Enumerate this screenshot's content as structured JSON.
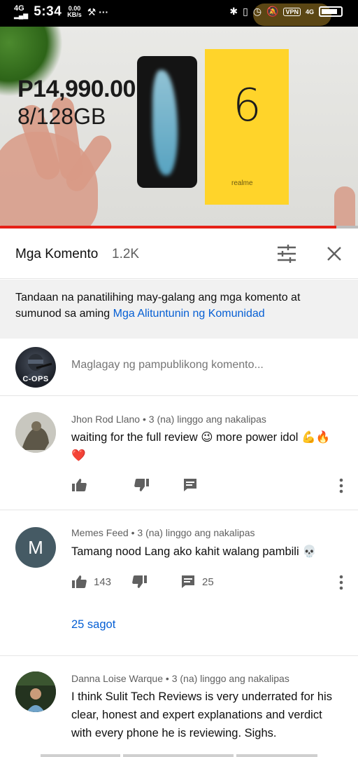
{
  "status_bar": {
    "network": "4G",
    "time": "5:34",
    "speed_value": "0.00",
    "speed_unit": "KB/s",
    "vpn": "VPN",
    "net_type": "4G"
  },
  "video": {
    "price_text": "P14,990.00",
    "storage_text": "8/128GB",
    "box_number": "6",
    "box_brand": "realme",
    "progress_percent": 94
  },
  "comments_header": {
    "title": "Mga Komento",
    "count": "1.2K"
  },
  "notice": {
    "text": "Tandaan na panatilihing may-galang ang mga komento at sumunod sa aming ",
    "link": "Mga Alituntunin ng Komunidad"
  },
  "add_comment": {
    "avatar_text": "C-OPS",
    "placeholder": "Maglagay ng pampublikong komento..."
  },
  "comments": [
    {
      "author": "Jhon Rod Llano",
      "time": "3 (na) linggo ang nakalipas",
      "text": "waiting for the full review 😉 more power idol 💪🔥",
      "text2": "❤️",
      "likes": "",
      "replies_count": ""
    },
    {
      "author": "Memes Feed",
      "avatar_letter": "M",
      "time": "3 (na) linggo ang nakalipas",
      "text": "Tamang nood Lang ako kahit walang pambili 💀",
      "likes": "143",
      "replies_count": "25",
      "replies_link": "25 sagot"
    },
    {
      "author": "Danna Loise Warque",
      "time": "3 (na) linggo ang nakalipas",
      "text": "I think Sulit Tech Reviews is very underrated for his clear, honest and expert explanations and verdict with every phone he is reviewing. Sighs."
    }
  ],
  "separator": "•",
  "colors": {
    "link": "#065fd4",
    "progress": "#e62117",
    "avatar_m": "#455a64"
  }
}
